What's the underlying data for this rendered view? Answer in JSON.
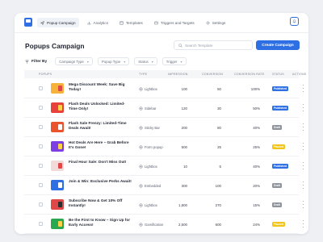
{
  "nav": {
    "tabs": [
      {
        "label": "Popup Campaign",
        "icon": "send-icon",
        "active": true
      },
      {
        "label": "Analytics",
        "icon": "chart-icon",
        "active": false
      },
      {
        "label": "Templates",
        "icon": "template-icon",
        "active": false
      },
      {
        "label": "Triggers and Targets",
        "icon": "target-icon",
        "active": false
      },
      {
        "label": "Settings",
        "icon": "gear-icon",
        "active": false
      }
    ]
  },
  "header": {
    "title": "Popups Campaign",
    "search_placeholder": "Search Template",
    "create_label": "Create Campaign"
  },
  "filters": {
    "label": "Filter By",
    "chips": [
      "Campaign Type",
      "Popup Type",
      "Status",
      "Trigger"
    ]
  },
  "table": {
    "columns": [
      "POPUPS",
      "TYPE",
      "IMPRESSION",
      "CONVERSION",
      "CONVERSION RATE",
      "STATUS",
      "ACTIONS"
    ],
    "rows": [
      {
        "name": "Mega Discount Week: Save Big Today!",
        "type": "Lightbox",
        "impression": "100",
        "conversion": "50",
        "rate": "100%",
        "status": "Published",
        "thumb": "#f6b23a",
        "accent": "#e04848"
      },
      {
        "name": "Flash Deals Unlocked: Limited-Time Only!",
        "type": "Sidebar",
        "impression": "120",
        "conversion": "30",
        "rate": "50%",
        "status": "Published",
        "thumb": "#e8413c",
        "accent": "#ffd24a"
      },
      {
        "name": "Flash Sale Frenzy: Limited-Time Deals Await!",
        "type": "Sticky Bar",
        "impression": "200",
        "conversion": "80",
        "rate": "40%",
        "status": "Draft",
        "thumb": "#e9542f",
        "accent": "#ffffff"
      },
      {
        "name": "Hot Deals Are Here – Grab Before It's Gone!",
        "type": "Form popup",
        "impression": "500",
        "conversion": "25",
        "rate": "25%",
        "status": "Paused",
        "thumb": "#7b3fe4",
        "accent": "#ffd24a"
      },
      {
        "name": "Final Hour Sale: Don't Miss Out!",
        "type": "Lightbox",
        "impression": "10",
        "conversion": "5",
        "rate": "40%",
        "status": "Published",
        "thumb": "#f3dada",
        "accent": "#e04848"
      },
      {
        "name": "Join & Win: Exclusive Perks Await!",
        "type": "Embedded",
        "impression": "300",
        "conversion": "100",
        "rate": "20%",
        "status": "Draft",
        "thumb": "#2f6fe4",
        "accent": "#ffffff"
      },
      {
        "name": "Subscribe Now & Get 10% Off Instantly!",
        "type": "Lightbox",
        "impression": "1,800",
        "conversion": "270",
        "rate": "15%",
        "status": "Draft",
        "thumb": "#e04848",
        "accent": "#2d2d2d"
      },
      {
        "name": "Be the First to Know – Sign Up for Early Access!",
        "type": "Gamification",
        "impression": "2,500",
        "conversion": "600",
        "rate": "24%",
        "status": "Paused",
        "thumb": "#2aa84f",
        "accent": "#ffd24a"
      }
    ]
  },
  "colors": {
    "accent": "#2f6fe4",
    "published": "#2f6fe4",
    "draft": "#8e939c",
    "paused": "#f0c419"
  }
}
